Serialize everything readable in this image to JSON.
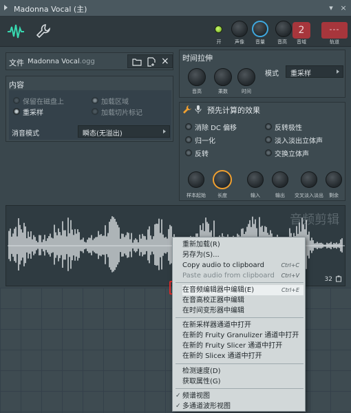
{
  "window": {
    "title": "Madonna Vocal (主)",
    "close_label": "×",
    "pin_label": "▾"
  },
  "toolbar": {
    "led_label": "开",
    "knobs": [
      "声像",
      "音量",
      "音高",
      "音域"
    ],
    "channel_number": "2",
    "track_label": "轨道",
    "track_value": "---"
  },
  "file": {
    "label": "文件",
    "name": "Madonna Vocal",
    "ext": ".ogg"
  },
  "content": {
    "title": "内容",
    "options": [
      {
        "label": "保留在磁盘上",
        "checked": false,
        "enabled": false
      },
      {
        "label": "加载区域",
        "checked": true,
        "enabled": false
      },
      {
        "label": "重采样",
        "checked": true,
        "enabled": true
      },
      {
        "label": "加载切片标记",
        "checked": false,
        "enabled": false
      }
    ],
    "declick_label": "消音模式",
    "declick_value": "瞬态(无溢出)"
  },
  "time_stretch": {
    "title": "时间拉伸",
    "knobs": [
      "音高",
      "乘数",
      "时间"
    ],
    "mode_label": "模式",
    "mode_value": "重采样"
  },
  "precomputed": {
    "title": "预先计算的效果",
    "options": [
      {
        "label": "消除 DC 偏移"
      },
      {
        "label": "反转极性"
      },
      {
        "label": "归一化"
      },
      {
        "label": "淡入淡出立体声"
      },
      {
        "label": "反转"
      },
      {
        "label": "交换立体声"
      }
    ],
    "knobs": [
      "样本起始",
      "长度",
      "输入",
      "输出",
      "交叉淡入淡出",
      "剩余"
    ]
  },
  "waveform": {
    "title": "音频剪辑",
    "counter": "32"
  },
  "context_menu": {
    "items": [
      {
        "label": "重新加载(R)",
        "shortcut": "",
        "enabled": true
      },
      {
        "label": "另存为(S)...",
        "shortcut": "",
        "enabled": true
      },
      {
        "label": "Copy audio to clipboard",
        "shortcut": "Ctrl+C",
        "enabled": true
      },
      {
        "label": "Paste audio from clipboard",
        "shortcut": "Ctrl+V",
        "enabled": false
      },
      {
        "label": "在音频编辑器中编辑(E)",
        "shortcut": "Ctrl+E",
        "enabled": true,
        "highlighted": true
      },
      {
        "label": "在音高校正器中编辑",
        "shortcut": "",
        "enabled": true
      },
      {
        "label": "在时间变形器中编辑",
        "shortcut": "",
        "enabled": true
      },
      {
        "label": "在新采样器通道中打开",
        "shortcut": "",
        "enabled": true
      },
      {
        "label": "在新的 Fruity Granulizer 通道中打开",
        "shortcut": "",
        "enabled": true
      },
      {
        "label": "在新的 Fruity Slicer 通道中打开",
        "shortcut": "",
        "enabled": true
      },
      {
        "label": "在新的 Slicex 通道中打开",
        "shortcut": "",
        "enabled": true
      },
      {
        "label": "检测速度(D)",
        "shortcut": "",
        "enabled": true
      },
      {
        "label": "获取属性(G)",
        "shortcut": "",
        "enabled": true
      },
      {
        "label": "频谱视图",
        "shortcut": "",
        "enabled": true,
        "checked": true
      },
      {
        "label": "多通道波形视图",
        "shortcut": "",
        "enabled": true,
        "checked": true
      }
    ]
  },
  "colors": {
    "accent_red": "#a7363c",
    "highlight_box": "#e02b2b",
    "knob_ring_blue": "#3fa9e0",
    "knob_ring_orange": "#f0a030",
    "led_green": "#8fd02a"
  }
}
